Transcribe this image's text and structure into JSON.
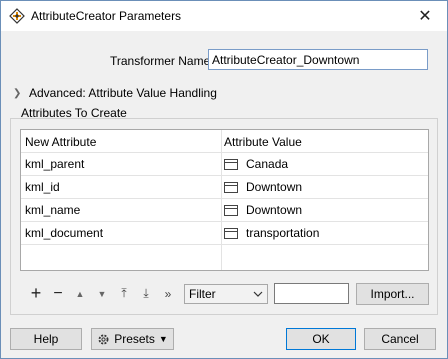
{
  "window": {
    "title": "AttributeCreator Parameters",
    "close_glyph": "✕"
  },
  "transformer": {
    "label": "Transformer Name:",
    "value": "AttributeCreator_Downtown"
  },
  "advanced": {
    "label": "Advanced: Attribute Value Handling"
  },
  "attributes_group": {
    "label": "Attributes To Create"
  },
  "table": {
    "headers": [
      "New Attribute",
      "Attribute Value"
    ],
    "rows": [
      {
        "name": "kml_parent",
        "value": "Canada"
      },
      {
        "name": "kml_id",
        "value": "Downtown"
      },
      {
        "name": "kml_name",
        "value": "Downtown"
      },
      {
        "name": "kml_document",
        "value": "transportation"
      }
    ]
  },
  "toolbar": {
    "add": "+",
    "remove": "−",
    "move_up": "▲",
    "move_down": "▼",
    "move_top": "⤒",
    "move_bottom": "⤓",
    "more": "»",
    "filter_label": "Filter",
    "filter_value": "",
    "import_label": "Import..."
  },
  "footer": {
    "help_label": "Help",
    "presets_label": "Presets",
    "ok_label": "OK",
    "cancel_label": "Cancel"
  },
  "colors": {
    "accent": "#0078d7"
  }
}
